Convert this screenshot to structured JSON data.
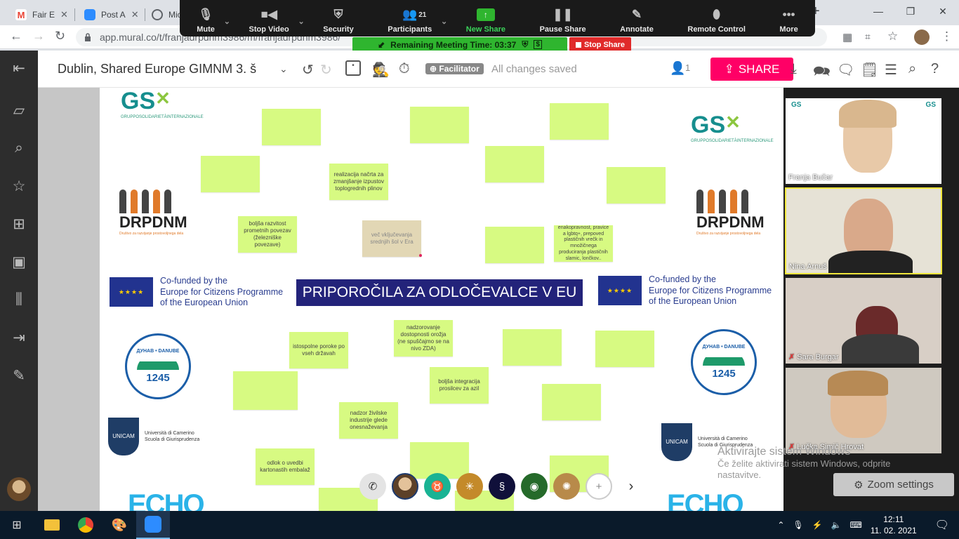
{
  "browser": {
    "tabs": [
      {
        "label": "Fair E",
        "color": "#ea4335"
      },
      {
        "label": "Post A",
        "color": "#2d8cff"
      },
      {
        "label": "Micr",
        "color": "#5f6368"
      }
    ],
    "new_tab": "+",
    "url": "app.mural.co/t/franjadrpdnm3986/m/franjadrpdnm3986/"
  },
  "zoom_toolbar": {
    "items": [
      {
        "label": "Mute",
        "icon": "microphone-icon"
      },
      {
        "label": "Stop Video",
        "icon": "video-camera-icon"
      },
      {
        "label": "Security",
        "icon": "shield-icon"
      },
      {
        "label": "Participants",
        "icon": "participants-icon",
        "count": "21"
      },
      {
        "label": "New Share",
        "icon": "share-up-arrow-icon"
      },
      {
        "label": "Pause Share",
        "icon": "pause-icon"
      },
      {
        "label": "Annotate",
        "icon": "pencil-icon"
      },
      {
        "label": "Remote Control",
        "icon": "mouse-icon"
      },
      {
        "label": "More",
        "icon": "ellipsis-icon"
      }
    ],
    "remaining_time": "Remaining Meeting Time: 03:37",
    "stop_share": "Stop Share"
  },
  "mural": {
    "title": "Dublin, Shared Europe GIMNM 3. š",
    "facilitator": "Facilitator",
    "status": "All changes saved",
    "user_count": "1",
    "share": "SHARE"
  },
  "canvas": {
    "banner": "PRIPOROČILA ZA ODLOČEVALCE V EU",
    "eu_text": [
      "Co-funded by the",
      "Europe for Citizens Programme",
      "of the European Union"
    ],
    "stickies": [
      "realizacija načrta za zmanjšanje izpustov toplogrednih plinov",
      "boljša razvitost prometnih povezav (železniške povezave)",
      "več vključevanja srednjih šol v Era",
      "enakopravnost, pravice a lgbtq+, prepoved plastičnih vrečk in množičnega produciranja plastičnih slamic, lončkov..",
      "nadzorovanje dostopnosti orožja (ne spuščajmo se na nivo ZDA)",
      "istospolne poroke po vseh državah",
      "boljša integracija prosilcev za azil",
      "nadzor živilske industrije glede onesnaževanja",
      "odlok o uvedbi kartonastih embalaž"
    ],
    "logos": {
      "gs": "GS",
      "gs_sub": "GRUPPOSOLIDARIETÀINTERNAZIONALE",
      "drpdnm": "DRPDNM",
      "drpdnm_sub": "Društvo za razvijanje prostovoljnega dela",
      "dunav_top": "ДУНАВ • DANUBE",
      "dunav_year": "1245",
      "unicam": "UNICAM",
      "unicam_text": [
        "Università di Camerino",
        "Scuola di Giurisprudenza"
      ],
      "echo": "ECHO"
    }
  },
  "participants": [
    {
      "name": "Franja Bučar"
    },
    {
      "name": "Nina Arnuš"
    },
    {
      "name": "Sara Burgar"
    },
    {
      "name": "Lučka Simič Hrovat"
    }
  ],
  "watermark": {
    "title": "Aktivirajte sistem Windows",
    "sub": "Če želite aktivirati sistem Windows, odprite nastavitve."
  },
  "zoom_settings": "Zoom settings",
  "taskbar": {
    "time": "12:11",
    "date": "11. 02. 2021"
  }
}
